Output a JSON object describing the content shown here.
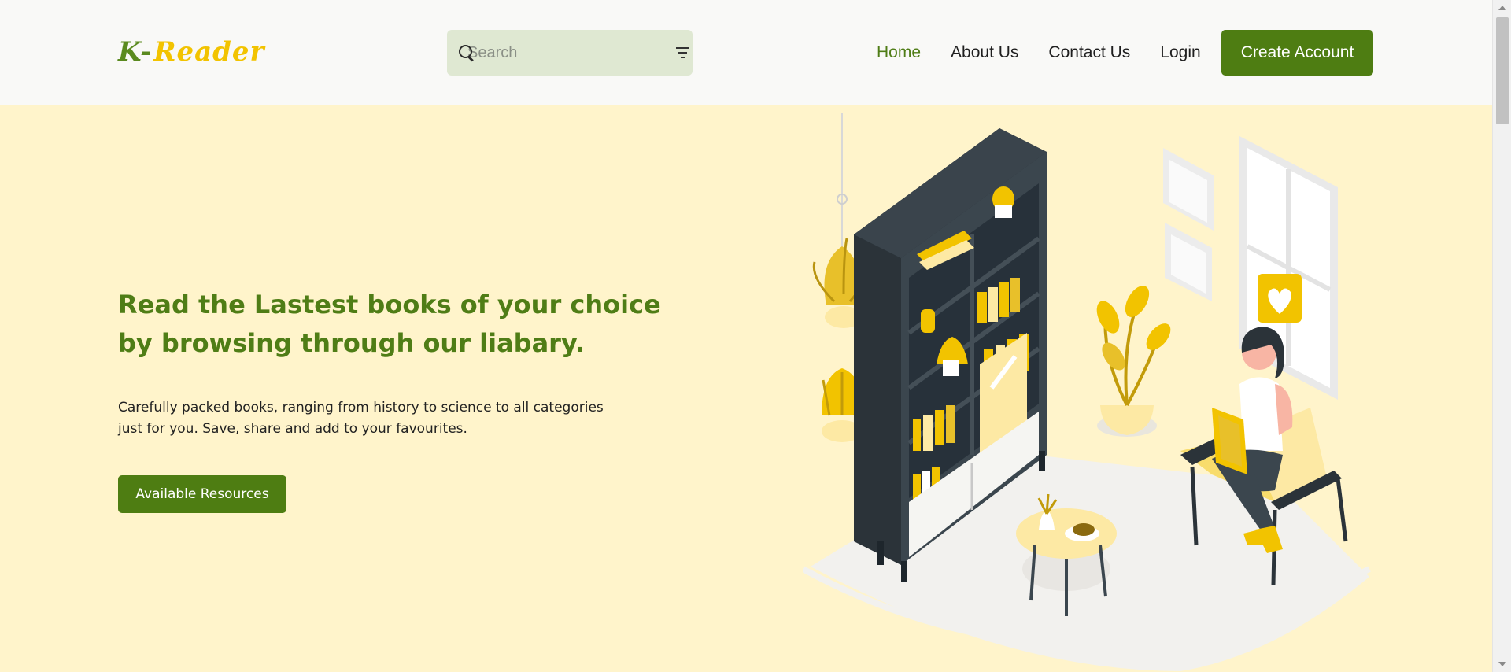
{
  "header": {
    "logo": {
      "part1": "K-",
      "part2": "Reader"
    },
    "search": {
      "placeholder": "Search",
      "value": ""
    },
    "nav": [
      {
        "label": "Home",
        "active": true
      },
      {
        "label": "About Us",
        "active": false
      },
      {
        "label": "Contact Us",
        "active": false
      },
      {
        "label": "Login",
        "active": false
      }
    ],
    "create_account_label": "Create Account"
  },
  "hero": {
    "title": "Read the Lastest books of your choice by browsing through our liabary.",
    "description": "Carefully packed books, ranging from history to science to all categories just for you. Save, share and add to your favourites.",
    "button_label": "Available Resources"
  },
  "colors": {
    "brand_green": "#4e7d12",
    "accent_yellow": "#f2c300",
    "hero_background": "#fff4cb",
    "search_background": "#dfe8d2"
  },
  "icons": [
    "search-icon",
    "filter-icon"
  ]
}
